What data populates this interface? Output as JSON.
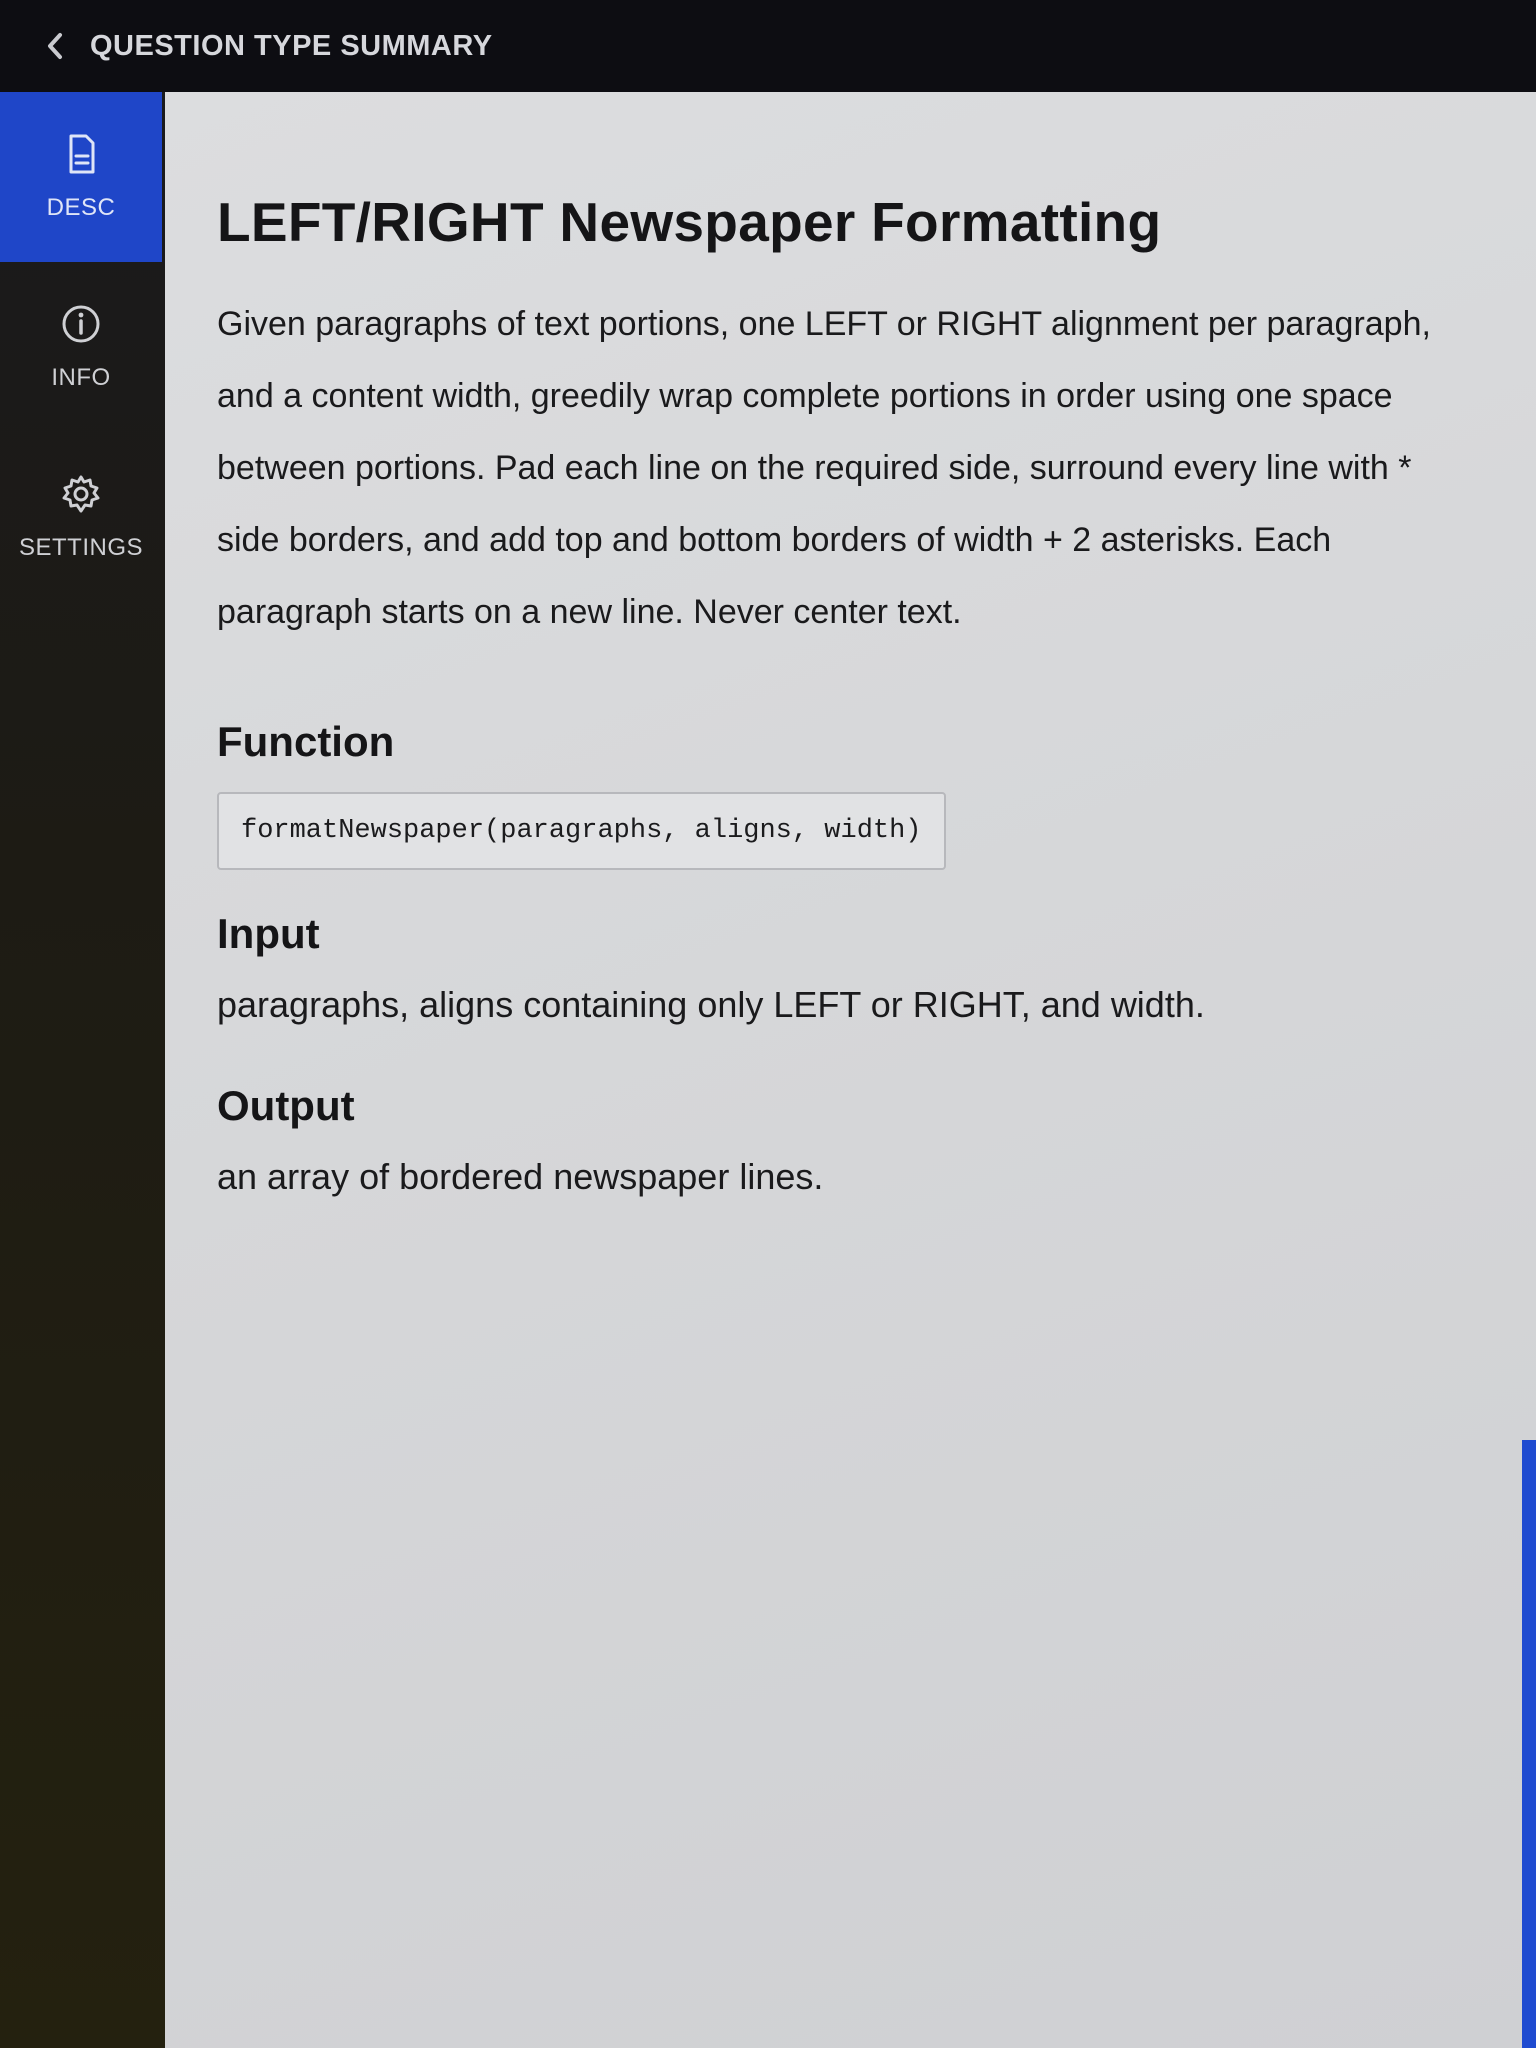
{
  "header": {
    "title": "QUESTION TYPE SUMMARY"
  },
  "sidebar": {
    "items": [
      {
        "label": "DESC",
        "icon": "document-icon",
        "active": true
      },
      {
        "label": "INFO",
        "icon": "info-icon",
        "active": false
      },
      {
        "label": "SETTINGS",
        "icon": "gear-icon",
        "active": false
      }
    ]
  },
  "main": {
    "title": "LEFT/RIGHT Newspaper Formatting",
    "description": "Given paragraphs of text portions, one LEFT or RIGHT alignment per paragraph, and a content width, greedily wrap complete portions in order using one space between portions. Pad each line on the required side, surround every line with * side borders, and add top and bottom borders of width + 2 asterisks. Each paragraph starts on a new line. Never center text.",
    "function_heading": "Function",
    "function_signature": "formatNewspaper(paragraphs, aligns, width)",
    "input_heading": "Input",
    "input_text": "paragraphs, aligns containing only LEFT or RIGHT, and width.",
    "output_heading": "Output",
    "output_text": "an array of bordered newspaper lines."
  },
  "colors": {
    "accent": "#1f46c8",
    "topbar": "#0d0d12",
    "panel": "#d6d7d9"
  }
}
